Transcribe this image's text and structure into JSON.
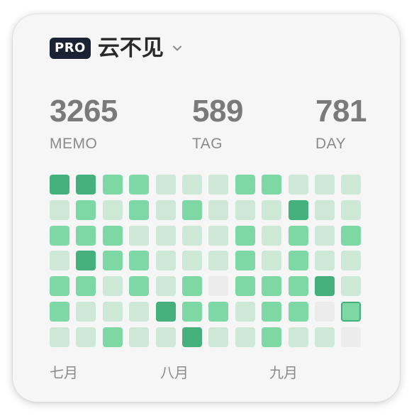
{
  "header": {
    "badge": "PRO",
    "username": "云不见",
    "chevron_icon": "chevron-down-icon"
  },
  "stats": [
    {
      "value": "3265",
      "label": "MEMO"
    },
    {
      "value": "589",
      "label": "TAG"
    },
    {
      "value": "781",
      "label": "DAY"
    }
  ],
  "heatmap": {
    "columns": 12,
    "rows": 7,
    "levels": [
      [
        3,
        3,
        2,
        2,
        1,
        1,
        1,
        2,
        2,
        1,
        1,
        1
      ],
      [
        1,
        2,
        1,
        2,
        1,
        2,
        1,
        1,
        1,
        3,
        1,
        1
      ],
      [
        2,
        2,
        2,
        1,
        1,
        1,
        1,
        2,
        1,
        2,
        1,
        2
      ],
      [
        1,
        3,
        2,
        2,
        1,
        1,
        1,
        2,
        1,
        2,
        1,
        1
      ],
      [
        2,
        2,
        1,
        2,
        1,
        2,
        0,
        2,
        2,
        2,
        3,
        1
      ],
      [
        2,
        1,
        1,
        1,
        3,
        2,
        2,
        1,
        2,
        2,
        0,
        4
      ],
      [
        1,
        1,
        2,
        1,
        1,
        3,
        1,
        1,
        2,
        1,
        1,
        0
      ]
    ],
    "colors": {
      "0": "#ececec",
      "1": "#cde8d7",
      "2": "#7dd8a5",
      "3": "#46b07c",
      "4": "#7dd8a5"
    },
    "selected_border": "#46b07c"
  },
  "months": [
    "七月",
    "八月",
    "九月"
  ]
}
